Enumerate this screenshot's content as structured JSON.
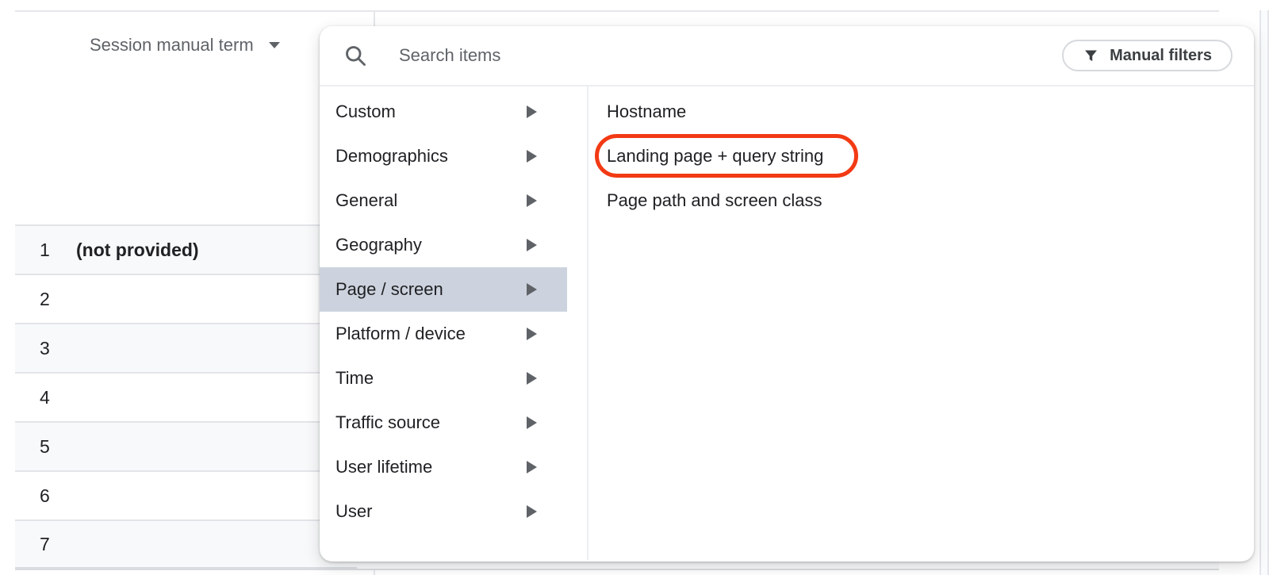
{
  "report": {
    "column_header": "Session manual term",
    "rows": [
      {
        "index": "1",
        "value": "(not provided)"
      },
      {
        "index": "2",
        "value": ""
      },
      {
        "index": "3",
        "value": ""
      },
      {
        "index": "4",
        "value": ""
      },
      {
        "index": "5",
        "value": ""
      },
      {
        "index": "6",
        "value": ""
      },
      {
        "index": "7",
        "value": ""
      }
    ]
  },
  "picker": {
    "search_placeholder": "Search items",
    "manual_filters_label": "Manual filters",
    "categories": [
      {
        "label": "Custom"
      },
      {
        "label": "Demographics"
      },
      {
        "label": "General"
      },
      {
        "label": "Geography"
      },
      {
        "label": "Page / screen",
        "selected": true
      },
      {
        "label": "Platform / device"
      },
      {
        "label": "Time"
      },
      {
        "label": "Traffic source"
      },
      {
        "label": "User lifetime"
      },
      {
        "label": "User"
      }
    ],
    "page_screen_items": [
      {
        "label": "Hostname"
      },
      {
        "label": "Landing page + query string",
        "annotated": true
      },
      {
        "label": "Page path and screen class"
      }
    ]
  },
  "colors": {
    "selected_category_bg": "#cdd3de",
    "annotation_red": "#f23a14",
    "row_alt_bg": "#f8f9fa",
    "text_primary": "#202124",
    "text_secondary": "#5f6368",
    "border": "#dadce0"
  }
}
